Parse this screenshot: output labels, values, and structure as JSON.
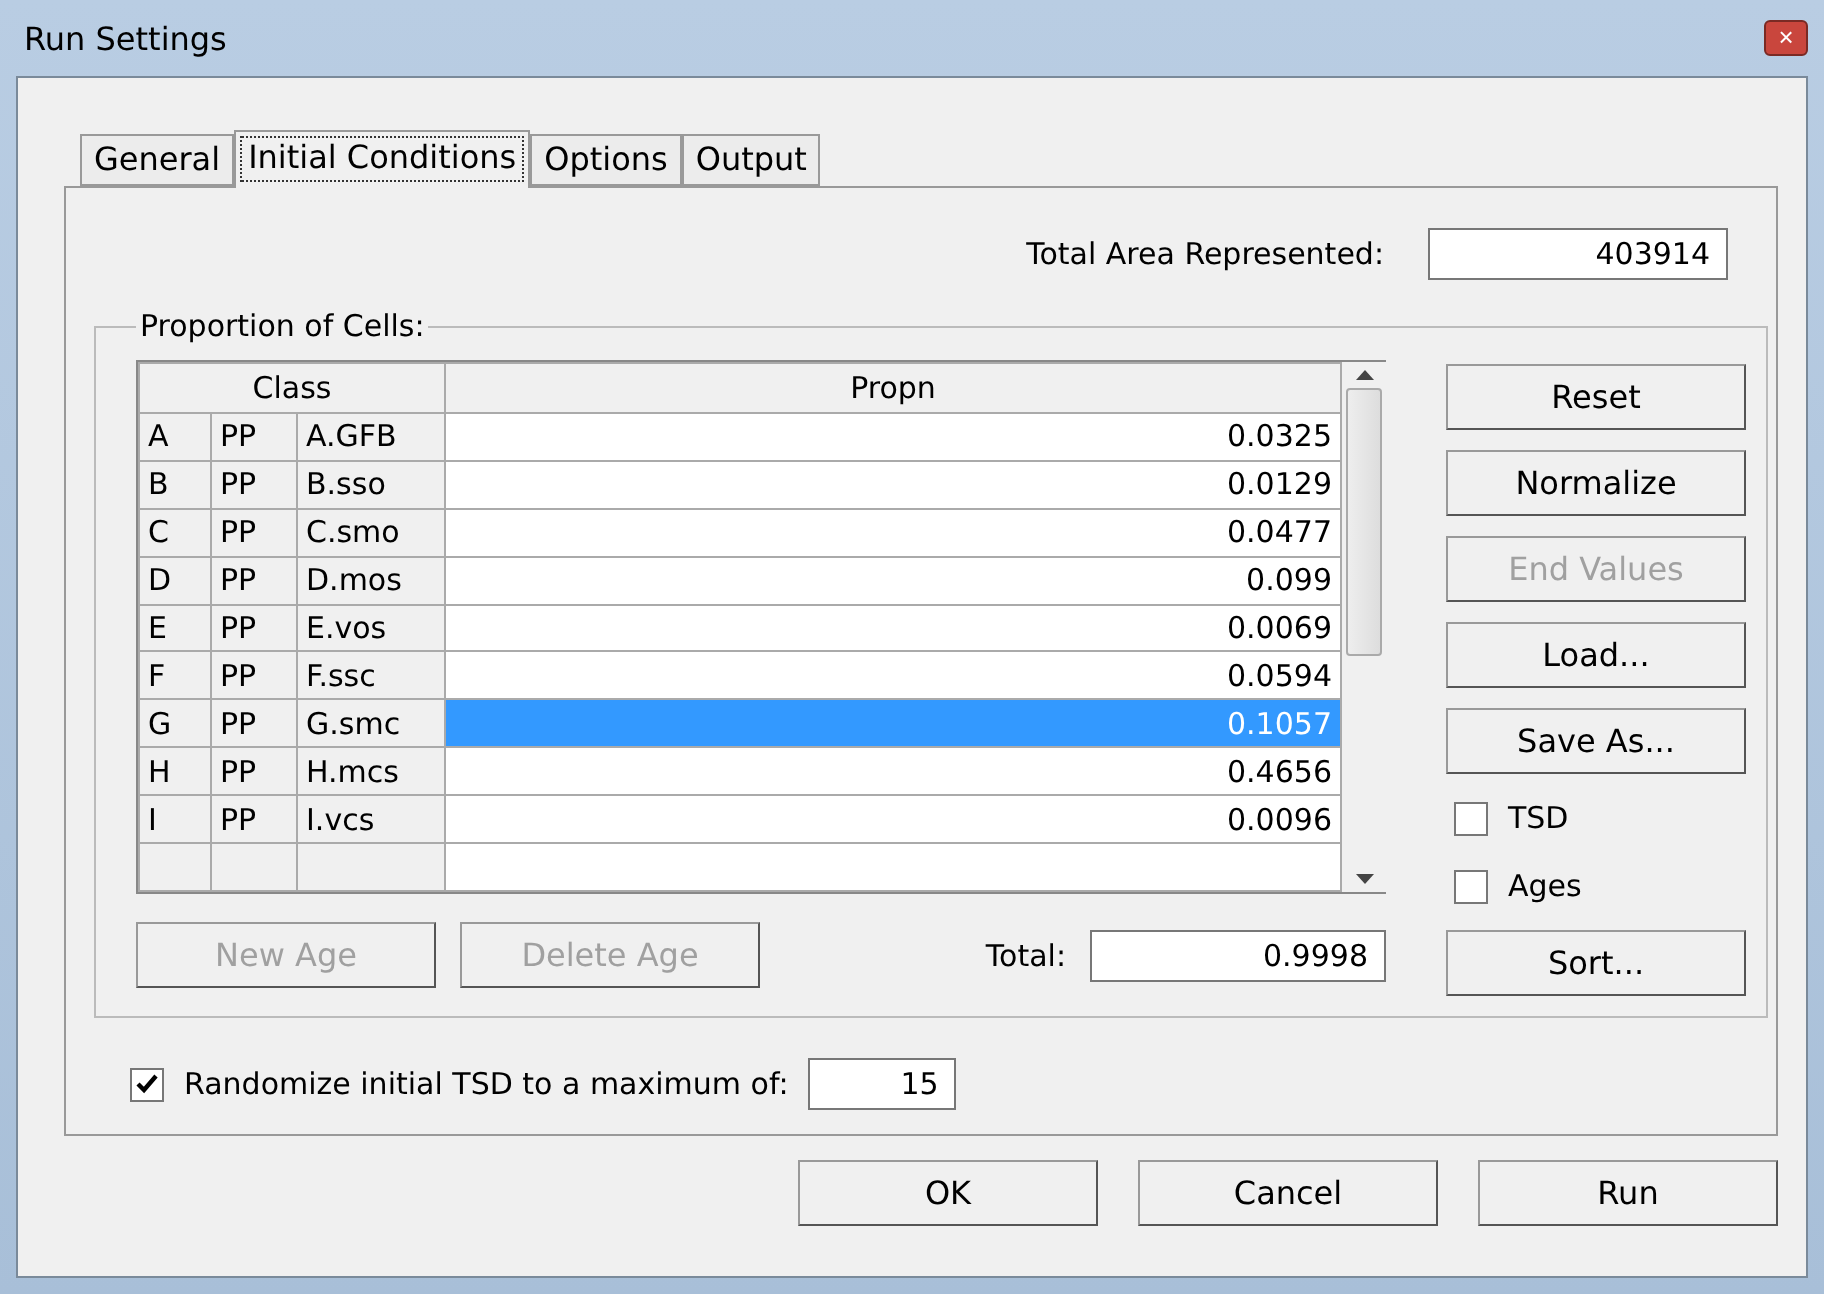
{
  "window": {
    "title": "Run Settings",
    "close": "×"
  },
  "tabs": [
    {
      "label": "General",
      "selected": false
    },
    {
      "label": "Initial Conditions",
      "selected": true
    },
    {
      "label": "Options",
      "selected": false
    },
    {
      "label": "Output",
      "selected": false
    }
  ],
  "total_area": {
    "label": "Total Area Represented:",
    "value": "403914"
  },
  "proportion_group": {
    "title": "Proportion of Cells:",
    "table": {
      "columns": [
        "Class",
        "Propn"
      ],
      "rows": [
        {
          "code": "A",
          "type": "PP",
          "name": "A.GFB",
          "propn": "0.0325",
          "selected": false
        },
        {
          "code": "B",
          "type": "PP",
          "name": "B.sso",
          "propn": "0.0129",
          "selected": false
        },
        {
          "code": "C",
          "type": "PP",
          "name": "C.smo",
          "propn": "0.0477",
          "selected": false
        },
        {
          "code": "D",
          "type": "PP",
          "name": "D.mos",
          "propn": "0.099",
          "selected": false
        },
        {
          "code": "E",
          "type": "PP",
          "name": "E.vos",
          "propn": "0.0069",
          "selected": false
        },
        {
          "code": "F",
          "type": "PP",
          "name": "F.ssc",
          "propn": "0.0594",
          "selected": false
        },
        {
          "code": "G",
          "type": "PP",
          "name": "G.smc",
          "propn": "0.1057",
          "selected": true
        },
        {
          "code": "H",
          "type": "PP",
          "name": "H.mcs",
          "propn": "0.4656",
          "selected": false
        },
        {
          "code": "I",
          "type": "PP",
          "name": "I.vcs",
          "propn": "0.0096",
          "selected": false
        }
      ]
    },
    "side_controls": [
      {
        "kind": "button",
        "label": "Reset",
        "disabled": false
      },
      {
        "kind": "button",
        "label": "Normalize",
        "disabled": false
      },
      {
        "kind": "button",
        "label": "End Values",
        "disabled": true
      },
      {
        "kind": "button",
        "label": "Load...",
        "disabled": false
      },
      {
        "kind": "button",
        "label": "Save As...",
        "disabled": false
      },
      {
        "kind": "checkbox",
        "label": "TSD",
        "checked": false
      },
      {
        "kind": "checkbox",
        "label": "Ages",
        "checked": false
      },
      {
        "kind": "button",
        "label": "Sort...",
        "disabled": false
      }
    ],
    "age_buttons": [
      {
        "label": "New Age",
        "disabled": true
      },
      {
        "label": "Delete Age",
        "disabled": true
      }
    ],
    "total": {
      "label": "Total:",
      "value": "0.9998"
    }
  },
  "randomize": {
    "label": "Randomize initial TSD to a maximum of:",
    "checked": true,
    "value": "15"
  },
  "buttons": [
    "OK",
    "Cancel",
    "Run"
  ]
}
